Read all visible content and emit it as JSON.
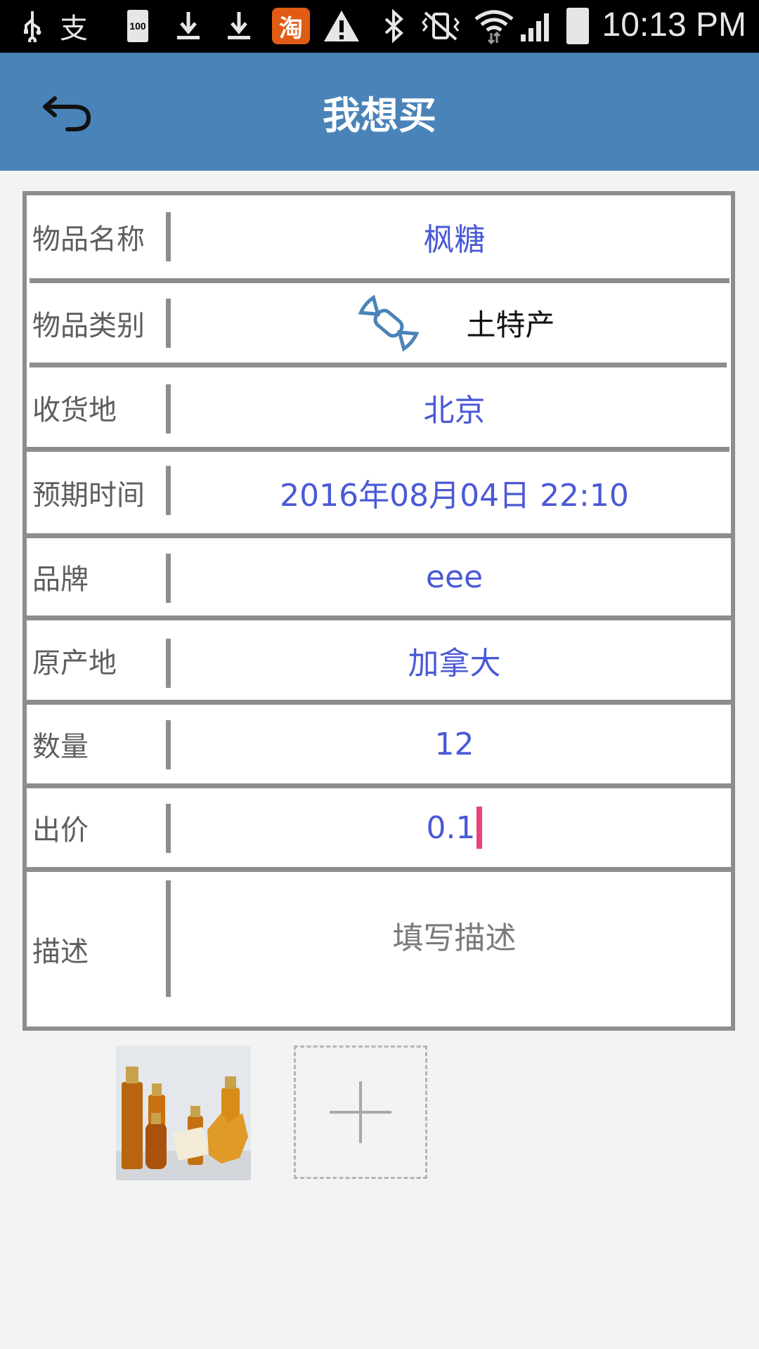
{
  "status_bar": {
    "time": "10:13 PM",
    "battery_level": "100",
    "icons": [
      "usb-icon",
      "alipay-icon",
      "battery-icon",
      "download-icon",
      "download-icon",
      "taobao-icon",
      "warning-icon",
      "bluetooth-icon",
      "vibrate-mute-icon",
      "wifi-icon",
      "signal-icon",
      "battery-full-icon"
    ],
    "taobao_glyph": "淘",
    "alipay_glyph": "支"
  },
  "app_bar": {
    "title": "我想买"
  },
  "form": {
    "item_name": {
      "label": "物品名称",
      "value": "枫糖"
    },
    "category": {
      "label": "物品类别",
      "value": "土特产"
    },
    "delivery_place": {
      "label": "收货地",
      "value": "北京"
    },
    "expected_time": {
      "label": "预期时间",
      "value": "2016年08月04日 22:10"
    },
    "brand": {
      "label": "品牌",
      "value": "eee"
    },
    "origin": {
      "label": "原产地",
      "value": "加拿大"
    },
    "quantity": {
      "label": "数量",
      "value": "12"
    },
    "price": {
      "label": "出价",
      "value": "0.1"
    },
    "description": {
      "label": "描述",
      "placeholder": "填写描述"
    }
  },
  "colors": {
    "app_bar": "#4a83b7",
    "value_text": "#4a59d6",
    "cursor": "#e8437a",
    "border": "#8d8d8d"
  }
}
